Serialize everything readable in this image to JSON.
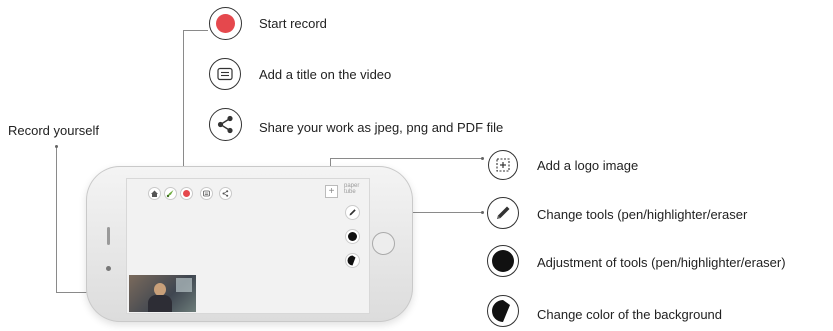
{
  "left_label": "Record yourself",
  "top_items": [
    {
      "label": "Start record",
      "icon": "record-icon"
    },
    {
      "label": "Add a title on the video",
      "icon": "title-icon"
    },
    {
      "label": "Share your work as jpeg, png and PDF file",
      "icon": "share-icon"
    }
  ],
  "right_items": [
    {
      "label": "Add a logo image",
      "icon": "logo-image-icon"
    },
    {
      "label": "Change tools (pen/highlighter/eraser",
      "icon": "pen-icon"
    },
    {
      "label": "Adjustment of tools (pen/highlighter/eraser)",
      "icon": "tool-size-icon"
    },
    {
      "label": "Change color of the background",
      "icon": "background-color-icon"
    }
  ],
  "phone": {
    "brand_line1": "paper",
    "brand_line2": "tube",
    "logo_placeholder": "+"
  },
  "colors": {
    "record_red": "#e5484d",
    "toolbar_green": "#6cab3c",
    "connector_gray": "#8a8a8a"
  }
}
